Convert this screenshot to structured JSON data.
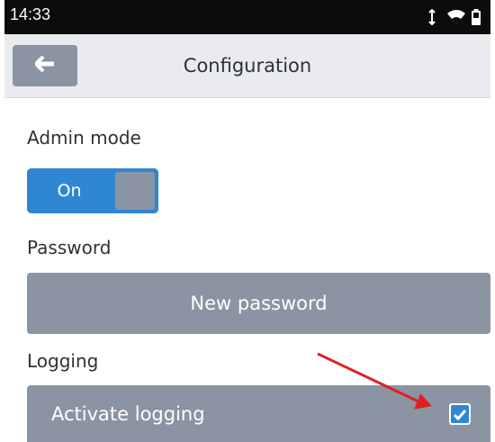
{
  "status_bar": {
    "time": "14:33",
    "icons": [
      "vibrate-icon",
      "wifi-icon",
      "battery-icon"
    ]
  },
  "app_bar": {
    "back_icon": "arrow-left-icon",
    "title": "Configuration"
  },
  "admin_mode": {
    "label": "Admin mode",
    "toggle_label": "On",
    "enabled": true
  },
  "password": {
    "label": "Password",
    "button_label": "New password"
  },
  "logging": {
    "label": "Logging",
    "row_label": "Activate logging",
    "checked": true
  },
  "colors": {
    "accent": "#2f87d4",
    "button_gray": "#8a94a2",
    "annotation_arrow": "#e02020"
  }
}
